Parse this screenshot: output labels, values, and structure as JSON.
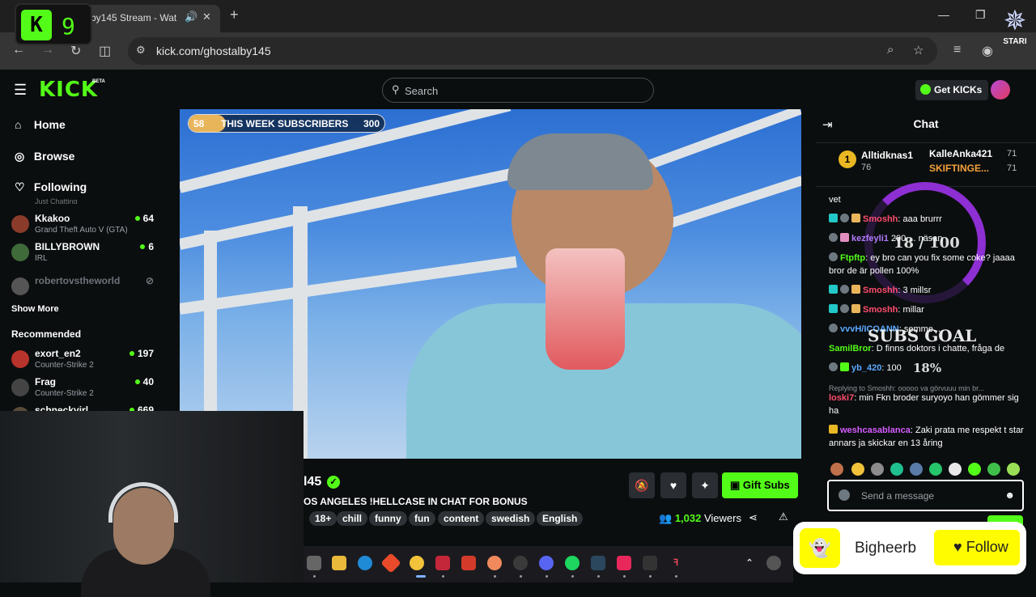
{
  "browser": {
    "tab_title": "by145 Stream - Wat",
    "url": "kick.com/ghostalby145",
    "new_tab": "+",
    "close": "✕"
  },
  "overlay": {
    "k9_letter": "K",
    "k9_number": "9",
    "stari_label": "STARI"
  },
  "header": {
    "logo": "KICK",
    "beta": "BETA",
    "search_placeholder": "Search",
    "get_kicks": "Get KICKs"
  },
  "sidebar": {
    "nav": [
      {
        "label": "Home",
        "icon": "home-icon"
      },
      {
        "label": "Browse",
        "icon": "compass-icon"
      },
      {
        "label": "Following",
        "icon": "heart-icon"
      }
    ],
    "following_cut": "Just Chatting",
    "following": [
      {
        "name": "Kkakoo",
        "category": "Grand Theft Auto V (GTA)",
        "viewers": "64",
        "color": "#8a3b2a"
      },
      {
        "name": "BILLYBROWN",
        "category": "IRL",
        "viewers": "6",
        "color": "#3f6a3a"
      },
      {
        "name": "robertovstheworld",
        "category": "",
        "viewers": "",
        "color": "#555"
      }
    ],
    "show_more": "Show More",
    "recommended_title": "Recommended",
    "recommended": [
      {
        "name": "exort_en2",
        "category": "Counter-Strike 2",
        "viewers": "197",
        "color": "#b8332b"
      },
      {
        "name": "Frag",
        "category": "Counter-Strike 2",
        "viewers": "40",
        "color": "#444"
      },
      {
        "name": "schneckvirl",
        "category": "",
        "viewers": "669",
        "color": "#5a4b3a"
      }
    ]
  },
  "video": {
    "subs_start": "58",
    "subs_label": "THIS WEEK SUBSCRIBERS",
    "subs_end": "300",
    "subs_progress": 0.19
  },
  "stream": {
    "streamer_name": "l45",
    "title": "OS ANGELES !HELLCASE IN CHAT FOR BONUS",
    "tags": [
      "18+",
      "chill",
      "funny",
      "fun",
      "content",
      "swedish",
      "English"
    ],
    "gift_subs": "Gift Subs",
    "viewers_count": "1,032",
    "viewers_label": "Viewers"
  },
  "chat": {
    "title": "Chat",
    "leaderboard": [
      {
        "rank": "1",
        "name": "Alltidknas1",
        "count": "76"
      },
      {
        "name": "KalleAnka421",
        "count": "71"
      },
      {
        "name": "SKIFTINGE...",
        "count": "71"
      }
    ],
    "messages": [
      {
        "user": "",
        "text": "vet",
        "color": "#fff"
      },
      {
        "user": "Smoshh",
        "text": "aaa brurrr",
        "color": "#ff4d6d"
      },
      {
        "user": "kezfeyli1",
        "text": "200 ... näsan",
        "color": "#b37bff"
      },
      {
        "user": "Ftpftp",
        "text": "ey bro can you fix some coke? jaaaa bror de är pollen 100%",
        "color": "#53fc18"
      },
      {
        "user": "Smoshh",
        "text": "3 millsr",
        "color": "#ff4d6d"
      },
      {
        "user": "Smoshh",
        "text": "millar",
        "color": "#ff4d6d"
      },
      {
        "user": "vvvH/ICOANN",
        "text": "semme...",
        "color": "#5aa9ff"
      },
      {
        "user": "SamilBror",
        "text": "D finns doktors i chatte, fråga de",
        "color": "#53fc18"
      },
      {
        "user": "yb_420",
        "text": "100",
        "color": "#5aa9ff"
      },
      {
        "user": "loski7",
        "text": "min Fkn broder suryoyo han gömmer sig ha",
        "color": "#ff4d6d"
      },
      {
        "user": "weshcasablanca",
        "text": "Zaki prata me respekt t star annars ja skickar en 13 åring",
        "color": "#d65bff"
      }
    ],
    "reply_hint": "Replying to Smoshh: ooooo va görvuuu min br...",
    "goal_count": "18 / 100",
    "goal_label": "SUBS GOAL",
    "goal_pct": "18%",
    "input_placeholder": "Send a message"
  },
  "popup": {
    "name": "Bigheerb",
    "follow": "Follow"
  }
}
